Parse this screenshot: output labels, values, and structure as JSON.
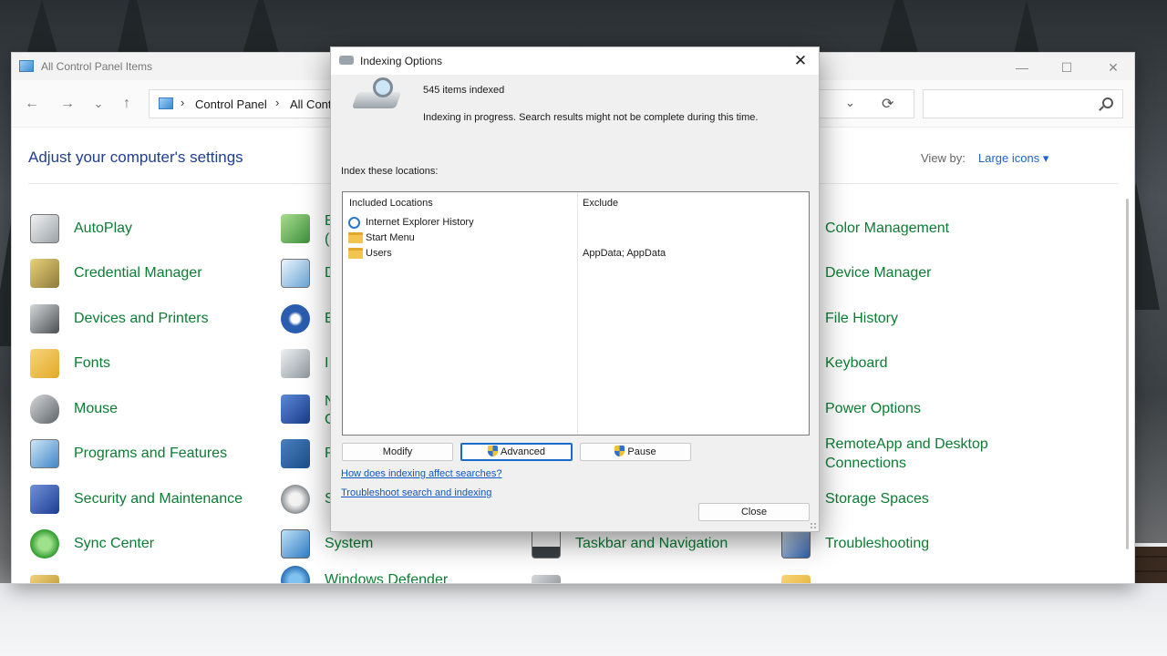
{
  "colors": {
    "link_green": "#0b7d33",
    "heading_blue": "#1e3f8f",
    "accent_blue": "#1b6ac9"
  },
  "control_panel": {
    "title": "All Control Panel Items",
    "window_controls": {
      "minimize": "—",
      "maximize": "☐",
      "close": "✕"
    },
    "nav": {
      "back": "←",
      "forward": "→",
      "recent": "⌄",
      "up": "↑"
    },
    "address": {
      "sep1": "›",
      "crumb1": "Control Panel",
      "sep2": "›",
      "crumb2": "All Cont"
    },
    "address_dropdown": "⌄",
    "refresh": "⟳",
    "search_placeholder": "",
    "heading": "Adjust your computer's settings",
    "view_by_label": "View by:",
    "view_by_value": "Large icons ▾",
    "col1": [
      "AutoPlay",
      "Credential Manager",
      "Devices and Printers",
      "Fonts",
      "Mouse",
      "Programs and Features",
      "Security and Maintenance",
      "Sync Center"
    ],
    "col2_partial": [
      "B",
      "(",
      "D",
      "E",
      "I",
      "N",
      "C",
      "R",
      "S"
    ],
    "col2_full": [
      "System",
      "Windows Defender"
    ],
    "col3": [
      "Taskbar and Navigation"
    ],
    "col4": [
      "Color Management",
      "Device Manager",
      "File History",
      "Keyboard",
      "Power Options",
      "RemoteApp and Desktop",
      "Connections",
      "Storage Spaces",
      "Troubleshooting"
    ]
  },
  "dialog": {
    "title": "Indexing Options",
    "close_glyph": "✕",
    "items_indexed": "545 items indexed",
    "status": "Indexing in progress. Search results might not be complete during this time.",
    "section_label": "Index these locations:",
    "columns": {
      "included": "Included Locations",
      "exclude": "Exclude"
    },
    "locations": [
      {
        "name": "Internet Explorer History",
        "exclude": "",
        "icon": "ie-icon"
      },
      {
        "name": "Start Menu",
        "exclude": "",
        "icon": "folder-icon"
      },
      {
        "name": "Users",
        "exclude": "AppData; AppData",
        "icon": "folder-icon"
      }
    ],
    "buttons": {
      "modify": "Modify",
      "advanced": "Advanced",
      "pause": "Pause",
      "close": "Close"
    },
    "links": {
      "how": "How does indexing affect searches?",
      "troubleshoot": "Troubleshoot search and indexing"
    }
  }
}
